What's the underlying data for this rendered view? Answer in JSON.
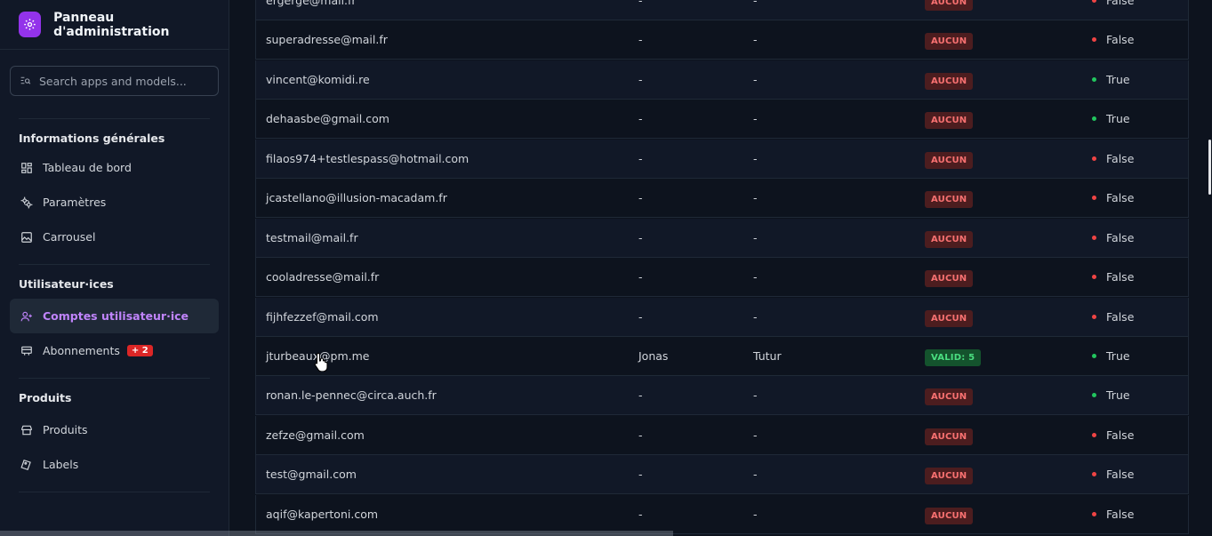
{
  "sidebar": {
    "brand_title": "Panneau d'administration",
    "search_placeholder": "Search apps and models...",
    "sections": [
      {
        "title": "Informations générales",
        "items": [
          {
            "label": "Tableau de bord",
            "icon": "dashboard-icon"
          },
          {
            "label": "Paramètres",
            "icon": "settings-icon"
          },
          {
            "label": "Carrousel",
            "icon": "image-icon"
          }
        ]
      },
      {
        "title": "Utilisateur·ices",
        "items": [
          {
            "label": "Comptes utilisateur·ice",
            "icon": "person-add-icon",
            "active": true
          },
          {
            "label": "Abonnements",
            "icon": "subscription-icon",
            "badge": "+ 2"
          }
        ]
      },
      {
        "title": "Produits",
        "items": [
          {
            "label": "Produits",
            "icon": "store-icon"
          },
          {
            "label": "Labels",
            "icon": "label-icon"
          }
        ]
      }
    ]
  },
  "table": {
    "rows": [
      {
        "email": "ergerge@mail.fr",
        "first": "-",
        "last": "-",
        "sub": "AUCUN",
        "active": "False"
      },
      {
        "email": "superadresse@mail.fr",
        "first": "-",
        "last": "-",
        "sub": "AUCUN",
        "active": "False"
      },
      {
        "email": "vincent@komidi.re",
        "first": "-",
        "last": "-",
        "sub": "AUCUN",
        "active": "True"
      },
      {
        "email": "dehaasbe@gmail.com",
        "first": "-",
        "last": "-",
        "sub": "AUCUN",
        "active": "True"
      },
      {
        "email": "filaos974+testlespass@hotmail.com",
        "first": "-",
        "last": "-",
        "sub": "AUCUN",
        "active": "False"
      },
      {
        "email": "jcastellano@illusion-macadam.fr",
        "first": "-",
        "last": "-",
        "sub": "AUCUN",
        "active": "False"
      },
      {
        "email": "testmail@mail.fr",
        "first": "-",
        "last": "-",
        "sub": "AUCUN",
        "active": "False"
      },
      {
        "email": "cooladresse@mail.fr",
        "first": "-",
        "last": "-",
        "sub": "AUCUN",
        "active": "False"
      },
      {
        "email": "fijhfezzef@mail.com",
        "first": "-",
        "last": "-",
        "sub": "AUCUN",
        "active": "False"
      },
      {
        "email": "jturbeaux@pm.me",
        "first": "Jonas",
        "last": "Tutur",
        "sub": "VALID: 5",
        "active": "True"
      },
      {
        "email": "ronan.le-pennec@circa.auch.fr",
        "first": "-",
        "last": "-",
        "sub": "AUCUN",
        "active": "True"
      },
      {
        "email": "zefze@gmail.com",
        "first": "-",
        "last": "-",
        "sub": "AUCUN",
        "active": "False"
      },
      {
        "email": "test@gmail.com",
        "first": "-",
        "last": "-",
        "sub": "AUCUN",
        "active": "False"
      },
      {
        "email": "aqif@kapertoni.com",
        "first": "-",
        "last": "-",
        "sub": "AUCUN",
        "active": "False"
      }
    ]
  },
  "colors": {
    "accent": "#9333ea",
    "active_nav": "#c084fc",
    "tag_none_bg": "#4c1d1f",
    "tag_none_text": "#f87171",
    "tag_valid_bg": "#14532d",
    "tag_valid_text": "#4ade80",
    "status_true": "#22c55e",
    "status_false": "#ef4444"
  }
}
